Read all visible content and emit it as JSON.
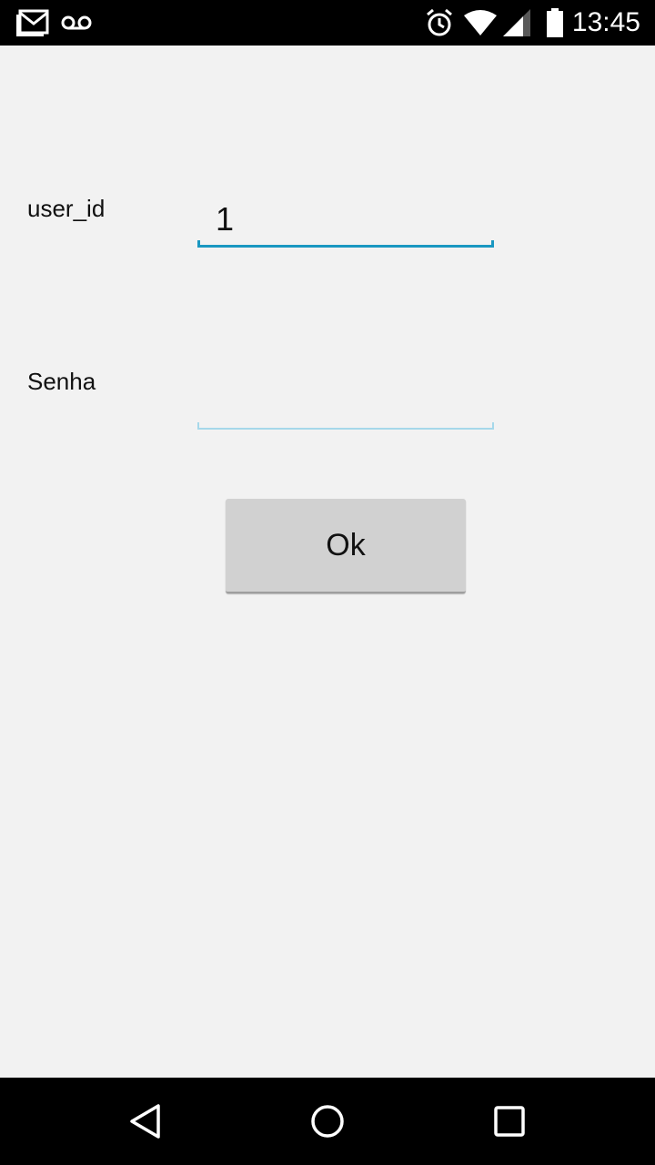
{
  "status_bar": {
    "time": "13:45",
    "icons": [
      "gmail-icon",
      "voicemail-icon",
      "alarm-icon",
      "wifi-icon",
      "signal-icon",
      "battery-icon"
    ]
  },
  "form": {
    "user_id_label": "user_id",
    "user_id_value": "1",
    "password_label": "Senha",
    "password_value": "",
    "ok_label": "Ok"
  },
  "nav_bar": {
    "buttons": [
      "back-icon",
      "home-icon",
      "recents-icon"
    ]
  },
  "colors": {
    "accent": "#1a97c1",
    "accent_inactive": "#a6d8ea",
    "background": "#f2f2f2",
    "button": "#d1d1d1"
  }
}
